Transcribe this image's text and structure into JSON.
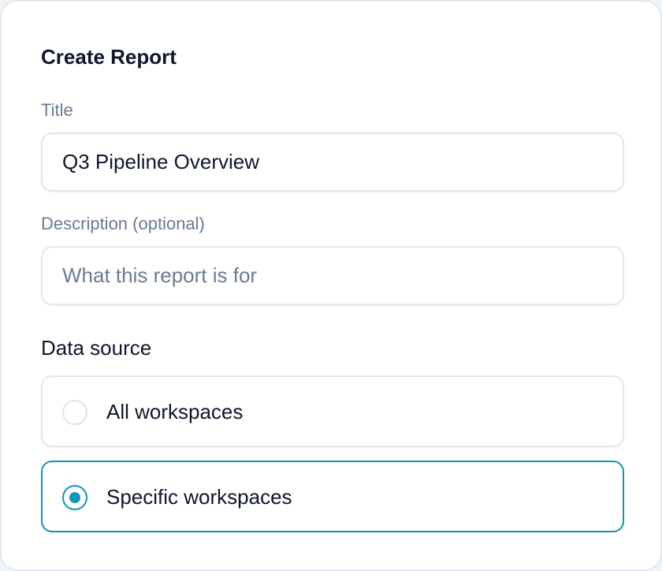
{
  "form": {
    "heading": "Create Report",
    "title_field": {
      "label": "Title",
      "value": "Q3 Pipeline Overview"
    },
    "description_field": {
      "label": "Description (optional)",
      "value": "",
      "placeholder": "What this report is for"
    },
    "data_source": {
      "label": "Data source",
      "options": [
        {
          "label": "All workspaces",
          "selected": false
        },
        {
          "label": "Specific workspaces",
          "selected": true
        }
      ]
    }
  },
  "colors": {
    "accent": "#1196b8",
    "label_muted": "#6b7a90",
    "text_primary": "#0f172a",
    "border": "#e3e7ed"
  }
}
